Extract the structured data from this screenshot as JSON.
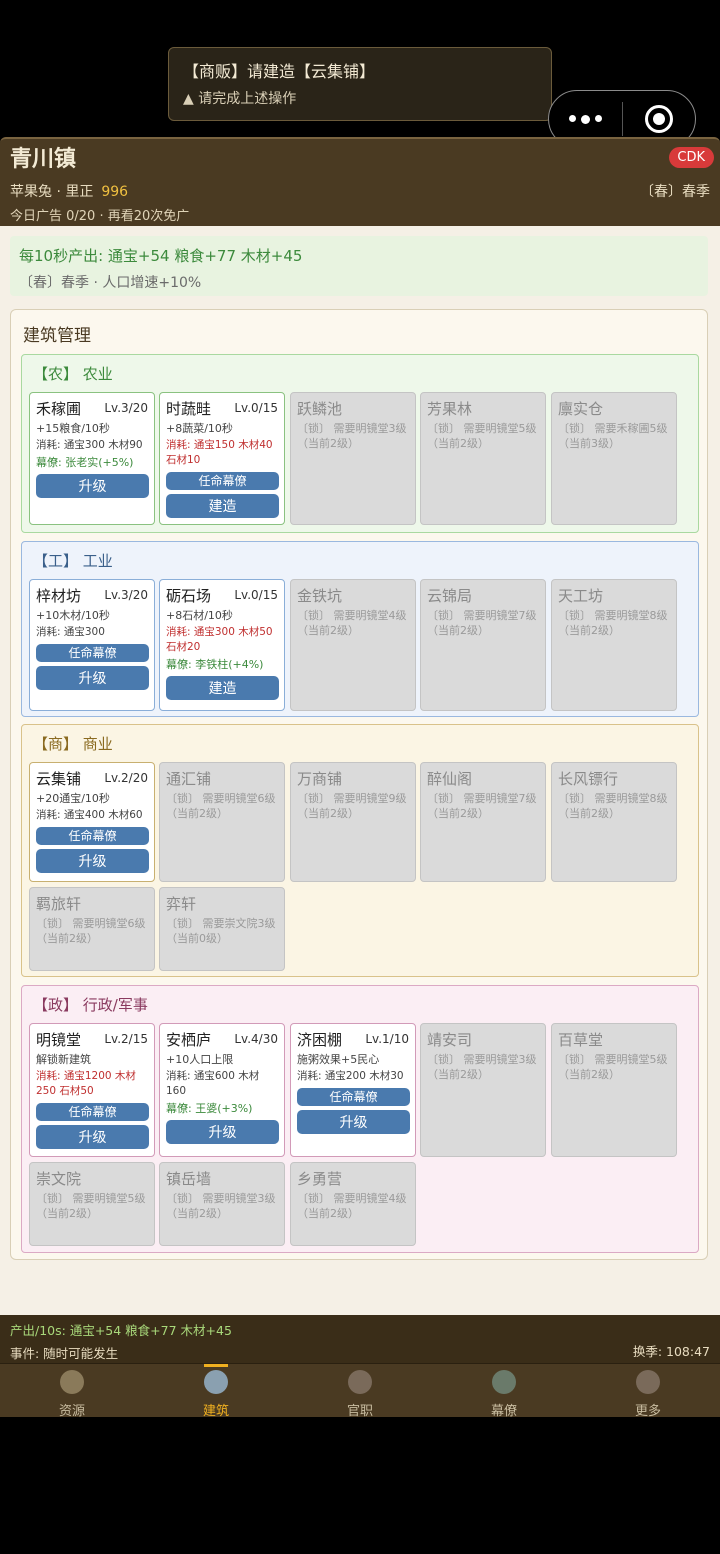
{
  "toast": {
    "title": "【商贩】请建造【云集铺】",
    "hint": "▲ 请完成上述操作"
  },
  "header": {
    "town": "青川镇",
    "player": "苹果兔 · 里正",
    "gold": "996",
    "ads": "今日广告 0/20 · 再看20次免广",
    "cdk": "CDK",
    "season": "〔春〕春季"
  },
  "production": {
    "line1": "每10秒产出: 通宝+54  粮食+77  木材+45",
    "line2": "〔春〕春季 · 人口增速+10%"
  },
  "panel_title": "建筑管理",
  "categories": [
    {
      "title": "【农】 农业",
      "cards": [
        {
          "name": "禾稼圃",
          "lv": "Lv.3/20",
          "lines": [
            "+15粮食/10秒",
            "消耗: 通宝300 木材90",
            "幕僚: 张老实(+5%)"
          ],
          "buttons": [
            "升级"
          ]
        },
        {
          "name": "时蔬畦",
          "lv": "Lv.0/15",
          "lines": [
            "+8蔬菜/10秒",
            "消耗: 通宝150 木材40 石材10"
          ],
          "buttons": [
            "任命幕僚",
            "建造"
          ]
        },
        {
          "name": "跃鳞池",
          "lines": [
            "〔锁〕 需要明镜堂3级（当前2级）"
          ]
        },
        {
          "name": "芳果林",
          "lines": [
            "〔锁〕 需要明镜堂5级（当前2级）"
          ]
        },
        {
          "name": "廪实仓",
          "lines": [
            "〔锁〕 需要禾稼圃5级（当前3级）"
          ]
        }
      ]
    },
    {
      "title": "【工】 工业",
      "cards": [
        {
          "name": "梓材坊",
          "lv": "Lv.3/20",
          "lines": [
            "+10木材/10秒",
            "消耗: 通宝300"
          ],
          "buttons": [
            "任命幕僚",
            "升级"
          ]
        },
        {
          "name": "砺石场",
          "lv": "Lv.0/15",
          "lines": [
            "+8石材/10秒",
            "消耗: 通宝300 木材50 石材20",
            "幕僚: 李铁柱(+4%)"
          ],
          "buttons": [
            "建造"
          ]
        },
        {
          "name": "金铁坑",
          "lines": [
            "〔锁〕 需要明镜堂4级（当前2级）"
          ]
        },
        {
          "name": "云锦局",
          "lines": [
            "〔锁〕 需要明镜堂7级（当前2级）"
          ]
        },
        {
          "name": "天工坊",
          "lines": [
            "〔锁〕 需要明镜堂8级（当前2级）"
          ]
        }
      ]
    },
    {
      "title": "【商】 商业",
      "cards": [
        {
          "name": "云集铺",
          "lv": "Lv.2/20",
          "lines": [
            "+20通宝/10秒",
            "消耗: 通宝400 木材60"
          ],
          "buttons": [
            "任命幕僚",
            "升级"
          ]
        },
        {
          "name": "通汇铺",
          "lines": [
            "〔锁〕 需要明镜堂6级（当前2级）"
          ]
        },
        {
          "name": "万商铺",
          "lines": [
            "〔锁〕 需要明镜堂9级（当前2级）"
          ]
        },
        {
          "name": "醉仙阁",
          "lines": [
            "〔锁〕 需要明镜堂7级（当前2级）"
          ]
        },
        {
          "name": "长风镖行",
          "lines": [
            "〔锁〕 需要明镜堂8级（当前2级）"
          ]
        },
        {
          "name": "羁旅轩",
          "lines": [
            "〔锁〕 需要明镜堂6级（当前2级）"
          ]
        },
        {
          "name": "弈轩",
          "lines": [
            "〔锁〕 需要崇文院3级（当前0级）"
          ]
        }
      ]
    },
    {
      "title": "【政】 行政/军事",
      "cards": [
        {
          "name": "明镜堂",
          "lv": "Lv.2/15",
          "lines": [
            "解锁新建筑",
            "消耗: 通宝1200 木材250 石材50"
          ],
          "buttons": [
            "任命幕僚",
            "升级"
          ]
        },
        {
          "name": "安栖庐",
          "lv": "Lv.4/30",
          "lines": [
            "+10人口上限",
            "消耗: 通宝600 木材160",
            "幕僚: 王婆(+3%)"
          ],
          "buttons": [
            "升级"
          ]
        },
        {
          "name": "济困棚",
          "lv": "Lv.1/10",
          "lines": [
            "施粥效果+5民心",
            "消耗: 通宝200 木材30"
          ],
          "buttons": [
            "任命幕僚",
            "升级"
          ]
        },
        {
          "name": "靖安司",
          "lines": [
            "〔锁〕 需要明镜堂3级（当前2级）"
          ]
        },
        {
          "name": "百草堂",
          "lines": [
            "〔锁〕 需要明镜堂5级（当前2级）"
          ]
        },
        {
          "name": "崇文院",
          "lines": [
            "〔锁〕 需要明镜堂5级（当前2级）"
          ]
        },
        {
          "name": "镇岳墙",
          "lines": [
            "〔锁〕 需要明镜堂3级（当前2级）"
          ]
        },
        {
          "name": "乡勇营",
          "lines": [
            "〔锁〕 需要明镜堂4级（当前2级）"
          ]
        }
      ]
    }
  ],
  "footer": {
    "output": "产出/10s: 通宝+54 粮食+77 木材+45",
    "event": "事件: 随时可能发生",
    "season_timer": "换季: 108:47"
  },
  "tabs": [
    {
      "label": "资源",
      "icon": "resource-icon"
    },
    {
      "label": "建筑",
      "icon": "building-icon",
      "active": true
    },
    {
      "label": "官职",
      "icon": "official-icon"
    },
    {
      "label": "幕僚",
      "icon": "advisor-icon"
    },
    {
      "label": "更多",
      "icon": "more-icon"
    }
  ],
  "colors": {
    "accent": "#4a7aae",
    "header_bg": "#4a3a22",
    "gold": "#f0c040",
    "active_tab": "#f0b020"
  }
}
